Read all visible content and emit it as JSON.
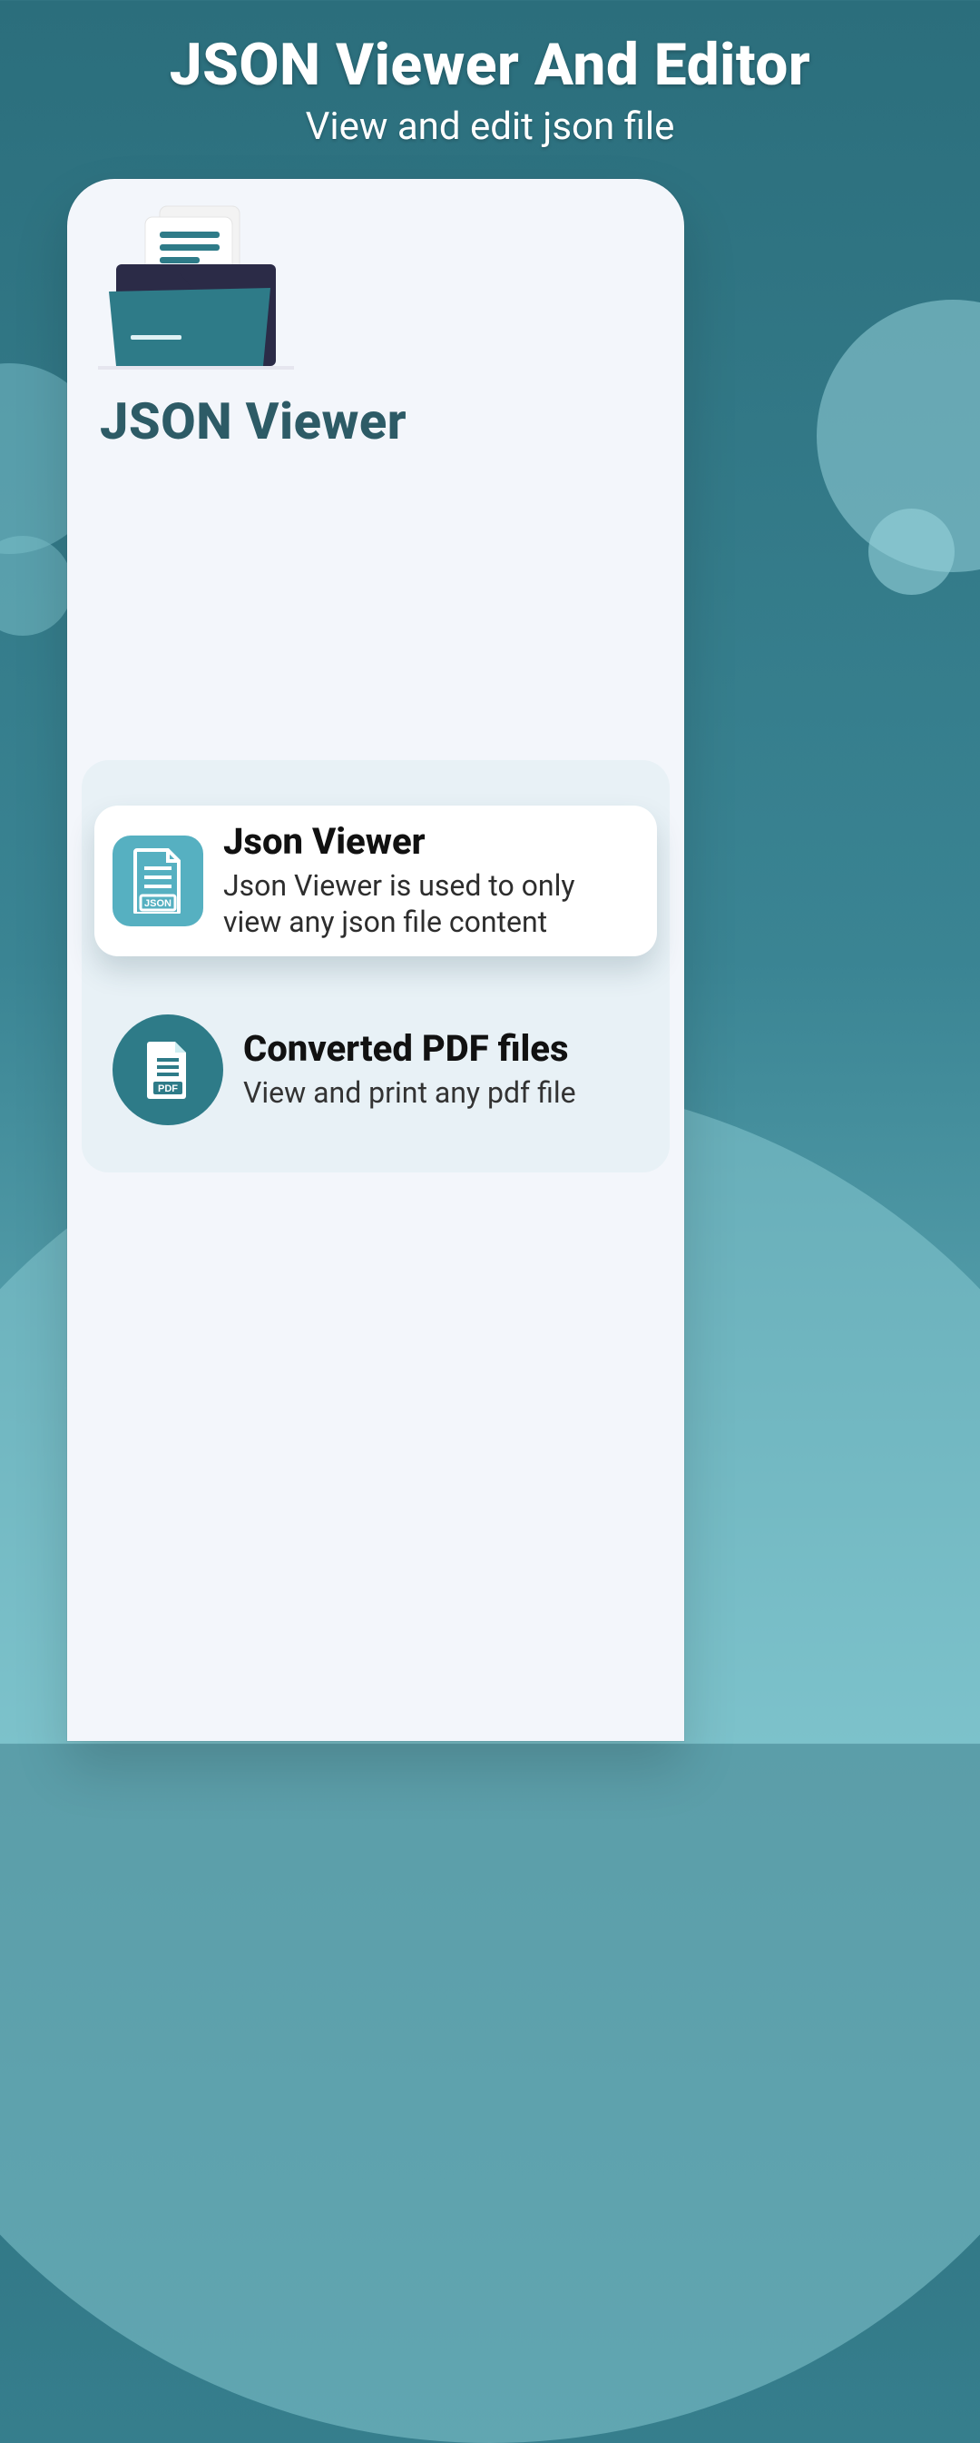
{
  "header": {
    "title": "JSON Viewer And Editor",
    "subtitle": "View and edit json file"
  },
  "card": {
    "title": "JSON Viewer"
  },
  "options": [
    {
      "title": "Json Viewer",
      "description": "Json Viewer is used to only view any json file content",
      "iconLabel": "JSON",
      "selected": true
    },
    {
      "title": "Converted PDF files",
      "description": "View and print any pdf file",
      "iconLabel": "PDF",
      "selected": false
    }
  ],
  "colors": {
    "tealDark": "#2e7b88",
    "tealLight": "#56b0c1",
    "cardBg": "#f3f6fb",
    "panelBg": "#e8f1f6",
    "titleColor": "#2d5b66"
  }
}
